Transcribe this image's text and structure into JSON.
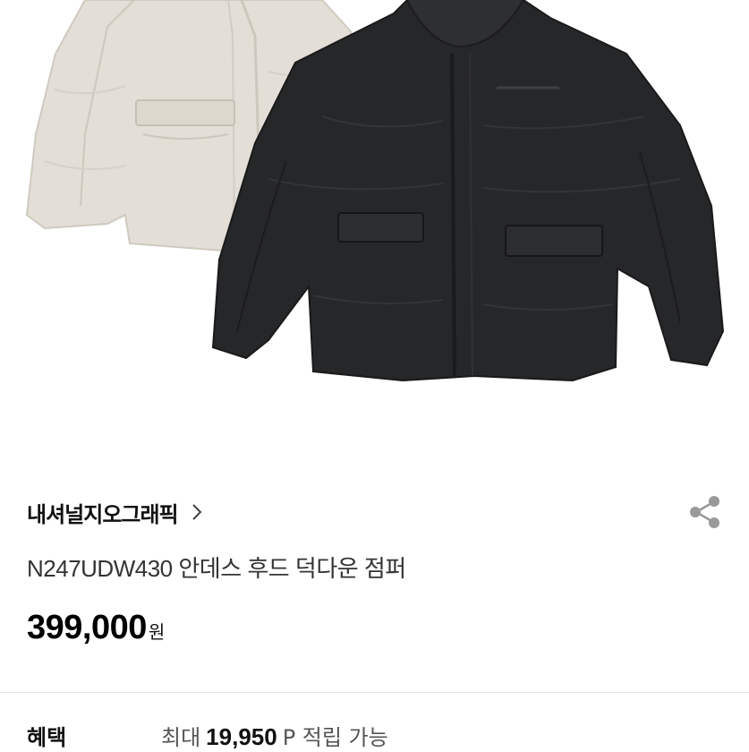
{
  "product": {
    "brand": "내셔널지오그래픽",
    "title": "N247UDW430 안데스 후드 덕다운 점퍼",
    "price": "399,000",
    "price_unit": "원"
  },
  "benefit": {
    "label": "혜택",
    "prefix": "최대",
    "points": "19,950",
    "suffix": "P 적립 가능"
  },
  "icons": {
    "brand_chevron": "chevron-right-icon",
    "share": "share-icon"
  },
  "colors": {
    "jacket_beige": "#e3dfd6",
    "jacket_black": "#262729",
    "divider": "#e5e5e5"
  }
}
